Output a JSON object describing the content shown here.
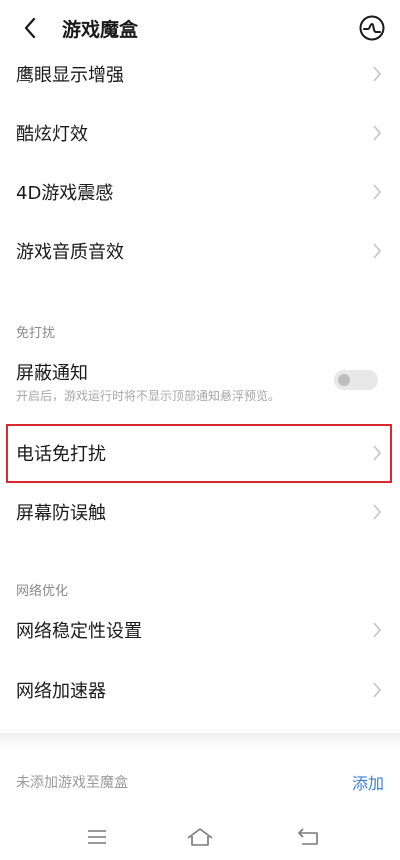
{
  "header": {
    "title": "游戏魔盒",
    "back_icon": "chevron-left-icon",
    "right_icon": "performance-icon"
  },
  "sections": {
    "top_items": [
      {
        "label": "鹰眼显示增强"
      },
      {
        "label": "酷炫灯效"
      },
      {
        "label": "4D游戏震感"
      },
      {
        "label": "游戏音质音效"
      }
    ],
    "no_disturb": {
      "title": "免打扰",
      "block_notifications": {
        "label": "屏蔽通知",
        "description": "开启后，游戏运行时将不显示顶部通知悬浮预览。",
        "enabled": false
      },
      "items": [
        {
          "label": "电话免打扰"
        },
        {
          "label": "屏幕防误触"
        }
      ]
    },
    "network": {
      "title": "网络优化",
      "items": [
        {
          "label": "网络稳定性设置"
        },
        {
          "label": "网络加速器"
        }
      ]
    }
  },
  "bottom_bar": {
    "info": "未添加游戏至魔盒",
    "action": "添加"
  },
  "colors": {
    "accent": "#3b82d6",
    "highlight": "#d9282f"
  }
}
